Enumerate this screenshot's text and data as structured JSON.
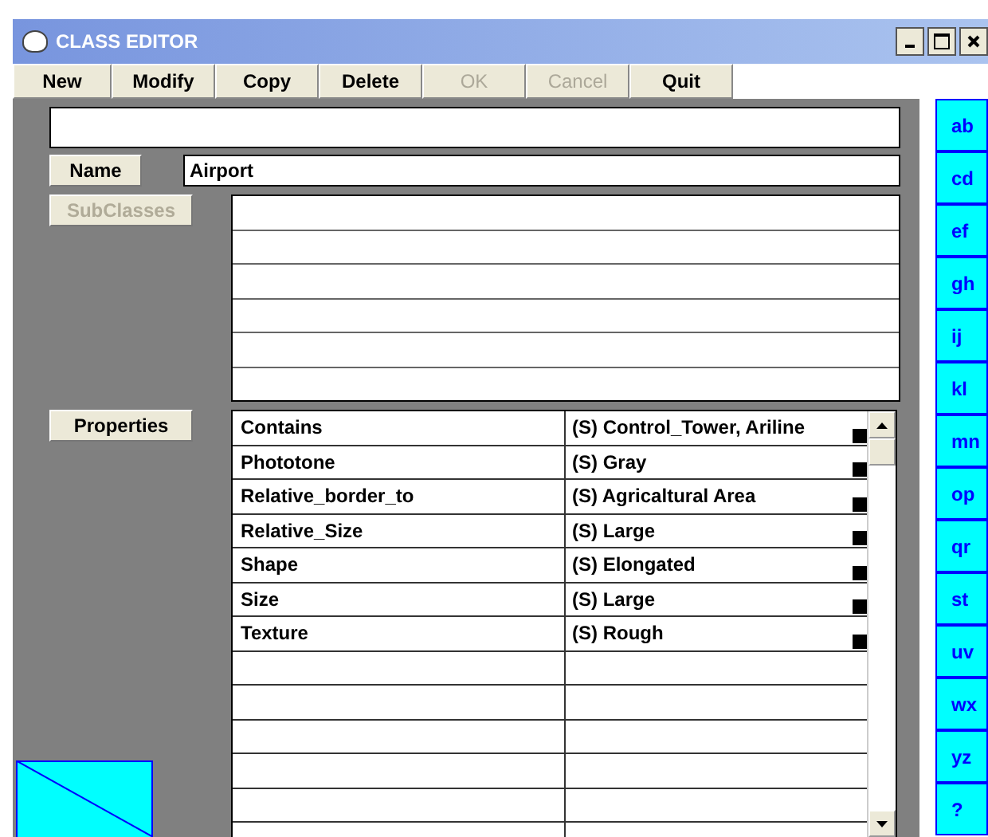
{
  "window": {
    "title": "CLASS EDITOR"
  },
  "toolbar": [
    {
      "label": "New",
      "disabled": false
    },
    {
      "label": "Modify",
      "disabled": false
    },
    {
      "label": "Copy",
      "disabled": false
    },
    {
      "label": "Delete",
      "disabled": false
    },
    {
      "label": "OK",
      "disabled": true
    },
    {
      "label": "Cancel",
      "disabled": true
    },
    {
      "label": "Quit",
      "disabled": false
    }
  ],
  "name_button": {
    "label": "Name",
    "disabled": false
  },
  "name_field": {
    "value": "Airport"
  },
  "subclasses_button": {
    "label": "SubClasses",
    "disabled": true
  },
  "properties_button": {
    "label": "Properties",
    "disabled": false
  },
  "properties": [
    {
      "name": "Contains",
      "value": "(S) Control_Tower, Ariline"
    },
    {
      "name": "Phototone",
      "value": "(S) Gray"
    },
    {
      "name": "Relative_border_to",
      "value": "(S) Agricaltural Area"
    },
    {
      "name": "Relative_Size",
      "value": "(S) Large"
    },
    {
      "name": "Shape",
      "value": "(S) Elongated"
    },
    {
      "name": "Size",
      "value": "(S) Large"
    },
    {
      "name": "Texture",
      "value": "(S) Rough"
    }
  ],
  "index_buttons": [
    "ab",
    "cd",
    "ef",
    "gh",
    "ij",
    "kl",
    "mn",
    "op",
    "qr",
    "st",
    "uv",
    "wx",
    "yz",
    "?"
  ]
}
